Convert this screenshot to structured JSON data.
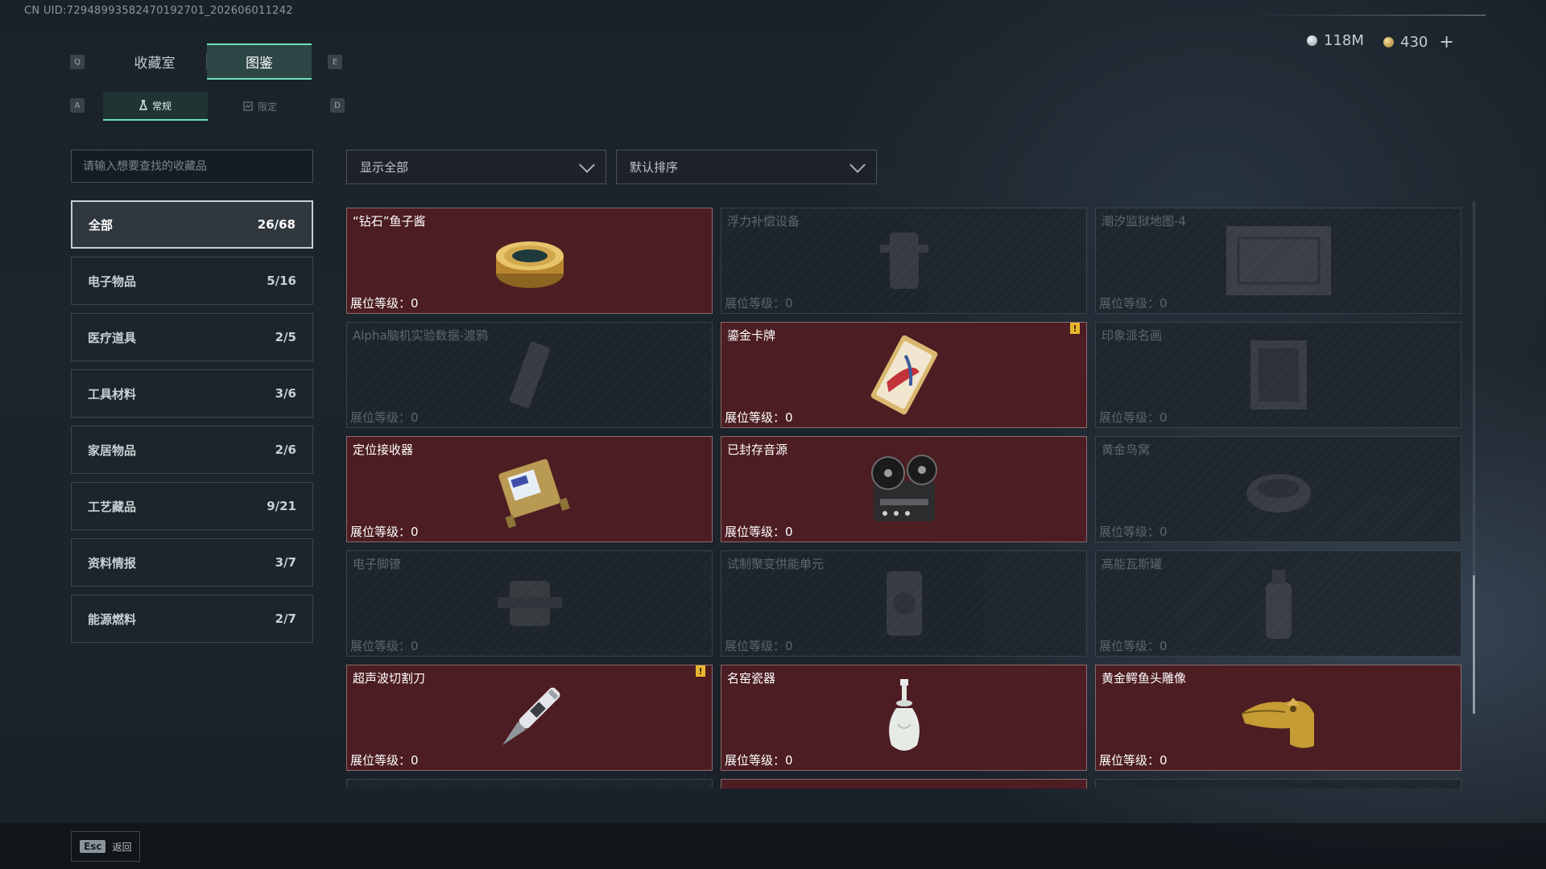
{
  "uid": "CN UID:72948993582470192701_202606011242",
  "currency": {
    "silver": "118M",
    "gold": "430",
    "add": "+"
  },
  "keys": {
    "q": "Q",
    "e": "E",
    "a": "A",
    "d": "D"
  },
  "tabs": {
    "collection": "收藏室",
    "codex": "图鉴"
  },
  "subtabs": {
    "regular": "常规",
    "limited": "限定"
  },
  "search": {
    "placeholder": "请输入想要查找的收藏品"
  },
  "filter": {
    "label": "显示全部"
  },
  "sort": {
    "label": "默认排序"
  },
  "categories": [
    {
      "label": "全部",
      "count": "26/68"
    },
    {
      "label": "电子物品",
      "count": "5/16"
    },
    {
      "label": "医疗道具",
      "count": "2/5"
    },
    {
      "label": "工具材料",
      "count": "3/6"
    },
    {
      "label": "家居物品",
      "count": "2/6"
    },
    {
      "label": "工艺藏品",
      "count": "9/21"
    },
    {
      "label": "资料情报",
      "count": "3/7"
    },
    {
      "label": "能源燃料",
      "count": "2/7"
    }
  ],
  "level_label": "展位等级：",
  "badge_text": "!",
  "items": [
    {
      "name": "“钻石”鱼子酱",
      "level": "0",
      "unlocked": true,
      "icon": "caviar-tin-icon"
    },
    {
      "name": "浮力补偿设备",
      "level": "0",
      "unlocked": false,
      "icon": "bcd-icon"
    },
    {
      "name": "潮汐监狱地图-4",
      "level": "0",
      "unlocked": false,
      "icon": "map-icon"
    },
    {
      "name": "Alpha脑机实验数据-渡鸦",
      "level": "0",
      "unlocked": false,
      "icon": "data-device-icon"
    },
    {
      "name": "鎏金卡牌",
      "level": "0",
      "unlocked": true,
      "icon": "gilded-card-icon"
    },
    {
      "name": "印象派名画",
      "level": "0",
      "unlocked": false,
      "icon": "painting-icon"
    },
    {
      "name": "定位接收器",
      "level": "0",
      "unlocked": true,
      "icon": "gps-receiver-icon"
    },
    {
      "name": "已封存音源",
      "level": "0",
      "unlocked": true,
      "icon": "reel-recorder-icon"
    },
    {
      "name": "黄金鸟窝",
      "level": "0",
      "unlocked": false,
      "icon": "golden-nest-icon"
    },
    {
      "name": "电子脚镣",
      "level": "0",
      "unlocked": false,
      "icon": "ankle-monitor-icon"
    },
    {
      "name": "试制聚变供能单元",
      "level": "0",
      "unlocked": false,
      "icon": "fusion-unit-icon"
    },
    {
      "name": "高能瓦斯罐",
      "level": "0",
      "unlocked": false,
      "icon": "gas-canister-icon"
    },
    {
      "name": "超声波切割刀",
      "level": "0",
      "unlocked": true,
      "icon": "ultrasonic-knife-icon"
    },
    {
      "name": "名窑瓷器",
      "level": "0",
      "unlocked": true,
      "icon": "porcelain-vase-icon"
    },
    {
      "name": "黄金鳄鱼头雕像",
      "level": "0",
      "unlocked": true,
      "icon": "gold-crocodile-icon"
    }
  ],
  "footer": {
    "key": "Esc",
    "label": "返回"
  },
  "colors": {
    "accent": "#6ee0b8",
    "unlocked_card": "#4c1d22",
    "badge": "#e7b72d"
  }
}
